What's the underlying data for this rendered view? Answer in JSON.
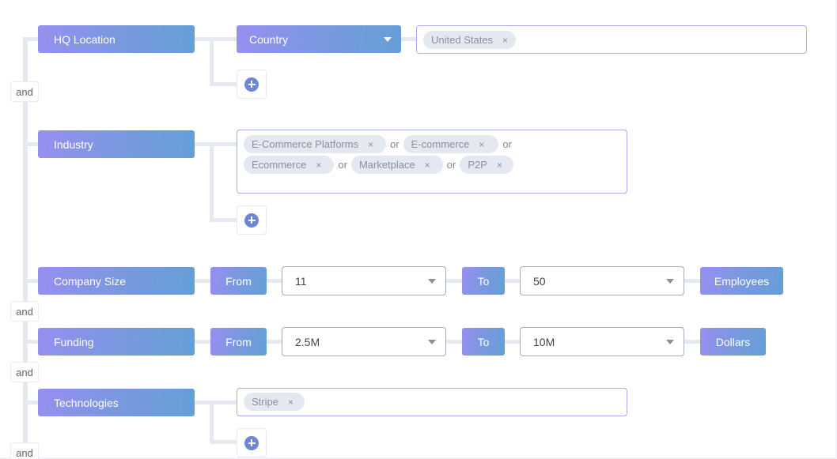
{
  "connector": "and",
  "or_label": "or",
  "remove_glyph": "×",
  "rows": {
    "hq_location": {
      "label": "HQ Location",
      "operator": "Country",
      "values": [
        "United States"
      ]
    },
    "industry": {
      "label": "Industry",
      "values": [
        "E-Commerce Platforms",
        "E-commerce",
        "Ecommerce",
        "Marketplace",
        "P2P"
      ]
    },
    "company_size": {
      "label": "Company Size",
      "from_label": "From",
      "from_value": "11",
      "to_label": "To",
      "to_value": "50",
      "unit": "Employees"
    },
    "funding": {
      "label": "Funding",
      "from_label": "From",
      "from_value": "2.5M",
      "to_label": "To",
      "to_value": "10M",
      "unit": "Dollars"
    },
    "technologies": {
      "label": "Technologies",
      "values": [
        "Stripe"
      ]
    }
  }
}
